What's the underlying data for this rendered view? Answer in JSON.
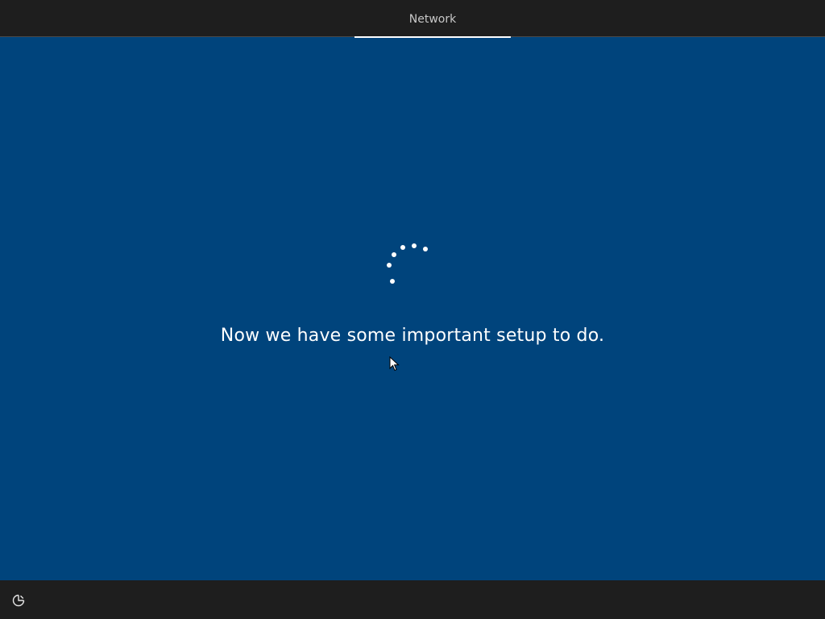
{
  "header": {
    "tabs": [
      {
        "label": "Network",
        "active": true
      }
    ]
  },
  "main": {
    "message": "Now we have some important setup to do.",
    "spinner_icon": "loading-spinner-icon"
  },
  "footer": {
    "ease_of_access_icon": "ease-of-access-icon"
  },
  "colors": {
    "background": "#00447c",
    "bars": "#1e1e1e",
    "text": "#ffffff",
    "tab_text": "#c8c8c8"
  }
}
